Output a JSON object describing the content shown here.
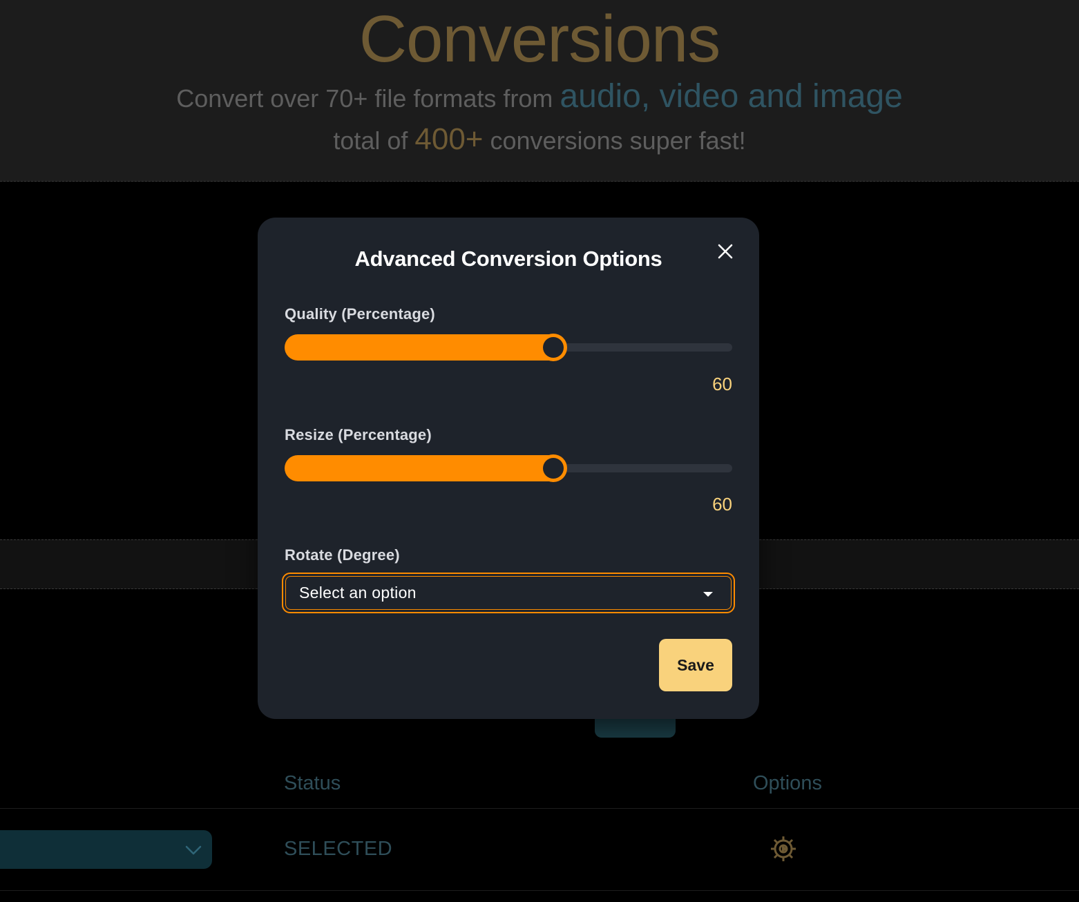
{
  "hero": {
    "title": "Conversions",
    "line1_prefix": "Convert over 70+ file formats from ",
    "line1_highlight": "audio, video and image",
    "line2_prefix": "total of ",
    "line2_highlight": "400+",
    "line2_suffix": " conversions super fast!"
  },
  "table": {
    "headers": {
      "status": "Status",
      "options": "Options"
    },
    "rows": [
      {
        "status": "SELECTED"
      }
    ]
  },
  "modal": {
    "title": "Advanced Conversion Options",
    "quality": {
      "label": "Quality (Percentage)",
      "value": "60",
      "percent": 60
    },
    "resize": {
      "label": "Resize (Percentage)",
      "value": "60",
      "percent": 60
    },
    "rotate": {
      "label": "Rotate (Degree)",
      "placeholder": "Select an option"
    },
    "save_label": "Save"
  },
  "icons": {
    "close": "close-icon",
    "dropdown": "caret-down-icon",
    "gear": "gear-icon",
    "chevron": "chevron-down-icon"
  },
  "colors": {
    "accent": "#ff8c00",
    "save_button": "#f9d27c",
    "value_text": "#f9d27c",
    "modal_bg": "#1e232b"
  }
}
